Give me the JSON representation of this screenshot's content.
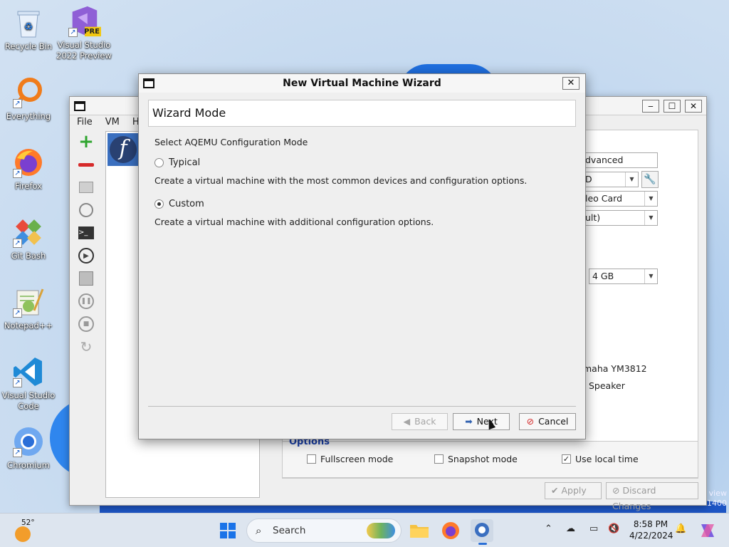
{
  "desktop": {
    "icons": [
      {
        "label": "Recycle Bin",
        "icon": "recycle-bin-icon"
      },
      {
        "label": "Visual Studio 2022 Preview",
        "icon": "visual-studio-preview-icon",
        "badge": "PRE"
      },
      {
        "label": "Everything",
        "icon": "everything-search-icon"
      },
      {
        "label": "Firefox",
        "icon": "firefox-icon"
      },
      {
        "label": "Git Bash",
        "icon": "git-bash-icon"
      },
      {
        "label": "Notepad++",
        "icon": "notepad-plus-plus-icon"
      },
      {
        "label": "Visual Studio Code",
        "icon": "vscode-icon"
      },
      {
        "label": "Chromium",
        "icon": "chromium-icon"
      }
    ]
  },
  "main_window": {
    "menu": [
      "File",
      "VM",
      "He"
    ],
    "vm_name_glyph": "f",
    "right_panel": {
      "mode_value": "dvanced",
      "cpu_value": "D",
      "video_value": "leo Card",
      "other_value": "ult)",
      "memory_value": "4 GB",
      "sound_1": "maha YM3812",
      "sound_2": "Speaker"
    },
    "options": {
      "title": "Options",
      "fullscreen": {
        "label": "Fullscreen mode",
        "checked": false
      },
      "snapshot": {
        "label": "Snapshot mode",
        "checked": false
      },
      "localtime": {
        "label": "Use local time",
        "checked": true
      }
    },
    "apply_label": "Apply",
    "discard_label": "Discard Changes",
    "watermark": "view",
    "watermark_num": "1400"
  },
  "wizard": {
    "title": "New Virtual Machine Wizard",
    "header": "Wizard Mode",
    "prompt": "Select AQEMU Configuration Mode",
    "typical_label": "Typical",
    "typical_desc": "Create a virtual machine with the most common devices and configuration options.",
    "custom_label": "Custom",
    "custom_desc": "Create a virtual machine with additional configuration options.",
    "selected": "custom",
    "back_label": "Back",
    "next_label": "Next",
    "cancel_label": "Cancel"
  },
  "taskbar": {
    "temperature": "52°",
    "search_label": "Search",
    "time": "8:58 PM",
    "date": "4/22/2024"
  }
}
